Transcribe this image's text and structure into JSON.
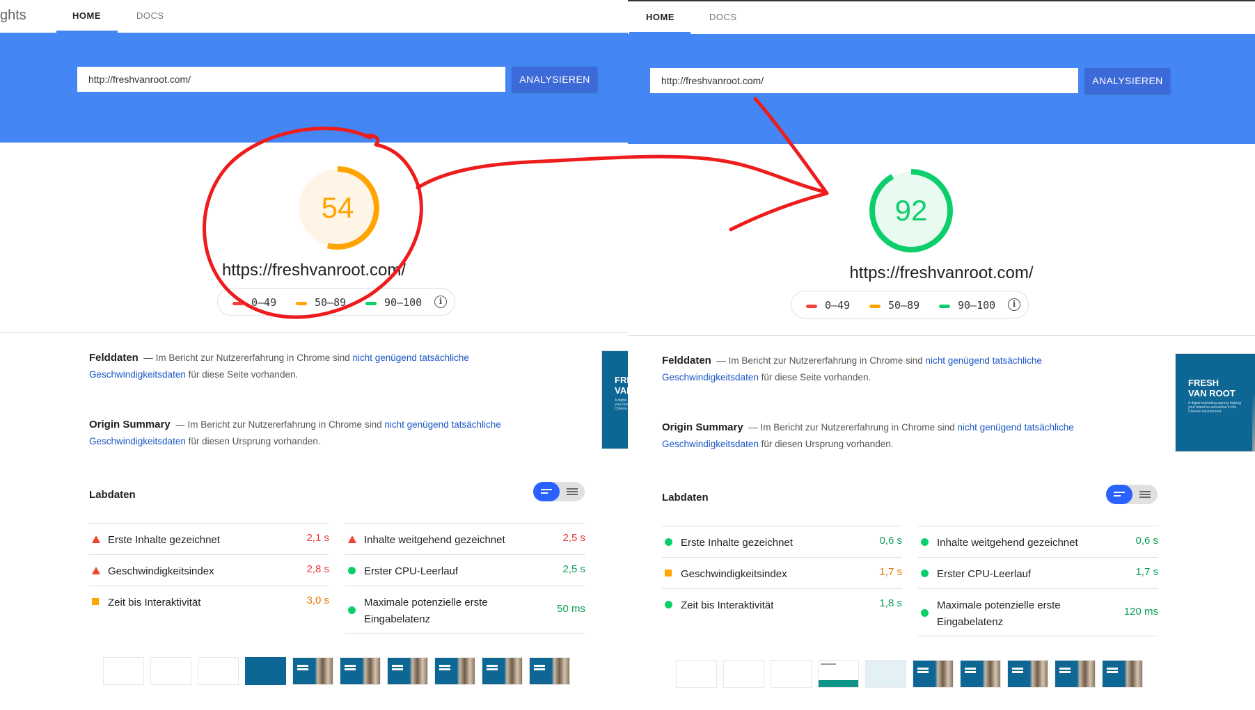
{
  "header": {
    "brand_fragment": "ghts",
    "tabs": [
      {
        "label": "HOME"
      },
      {
        "label": "DOCS"
      }
    ]
  },
  "search": {
    "url_value": "http://freshvanroot.com/",
    "analyze_label": "ANALYSIEREN"
  },
  "legend": {
    "ranges": [
      "0–49",
      "50–89",
      "90–100"
    ],
    "info_glyph": "i"
  },
  "colors": {
    "hero_blue": "#4486f4",
    "fail_red": "#f44336",
    "average_orange": "#ffa400",
    "pass_green": "#0cce6b"
  },
  "sections": {
    "field_title": "Felddaten",
    "origin_title": "Origin Summary",
    "text_prefix": "— Im Bericht zur Nutzererfahrung in Chrome sind",
    "link_text": "nicht genügend tatsächliche",
    "link_text_2": "Geschwindigkeitsdaten",
    "field_suffix": "für diese Seite vorhanden.",
    "origin_suffix": "für diesen Ursprung vorhanden.",
    "lab_title": "Labdaten"
  },
  "preview": {
    "title_line1": "FRESH",
    "title_line2": "VAN ROOT",
    "subtitle": "A digital marketing agency helping your brand be successful in the Chinese environment."
  },
  "before": {
    "score": 54,
    "score_fraction": 0.54,
    "status": "average",
    "final_url": "https://freshvanroot.com/",
    "metrics": [
      {
        "label": "Erste Inhalte gezeichnet",
        "value": "2,1 s",
        "status": "fail"
      },
      {
        "label": "Inhalte weitgehend gezeichnet",
        "value": "2,5 s",
        "status": "fail"
      },
      {
        "label": "Geschwindigkeitsindex",
        "value": "2,8 s",
        "status": "fail"
      },
      {
        "label": "Erster CPU-Leerlauf",
        "value": "2,5 s",
        "status": "pass"
      },
      {
        "label": "Zeit bis Interaktivität",
        "value": "3,0 s",
        "status": "average"
      },
      {
        "label": "Maximale potenzielle erste Eingabelatenz",
        "value": "50 ms",
        "status": "pass"
      }
    ]
  },
  "after": {
    "score": 92,
    "score_fraction": 0.92,
    "status": "pass",
    "final_url": "https://freshvanroot.com/",
    "metrics": [
      {
        "label": "Erste Inhalte gezeichnet",
        "value": "0,6 s",
        "status": "pass"
      },
      {
        "label": "Inhalte weitgehend gezeichnet",
        "value": "0,6 s",
        "status": "pass"
      },
      {
        "label": "Geschwindigkeitsindex",
        "value": "1,7 s",
        "status": "average"
      },
      {
        "label": "Erster CPU-Leerlauf",
        "value": "1,7 s",
        "status": "pass"
      },
      {
        "label": "Zeit bis Interaktivität",
        "value": "1,8 s",
        "status": "pass"
      },
      {
        "label": "Maximale potenzielle erste Eingabelatenz",
        "value": "120 ms",
        "status": "pass"
      }
    ]
  },
  "filmstrip": {
    "before": [
      "blank",
      "blank",
      "blank",
      "blue",
      "photo",
      "photo",
      "photo",
      "photo",
      "photo",
      "photo"
    ],
    "after": [
      "blank",
      "blank",
      "blank",
      "mini",
      "pale",
      "photo",
      "photo",
      "photo",
      "photo",
      "photo"
    ]
  }
}
